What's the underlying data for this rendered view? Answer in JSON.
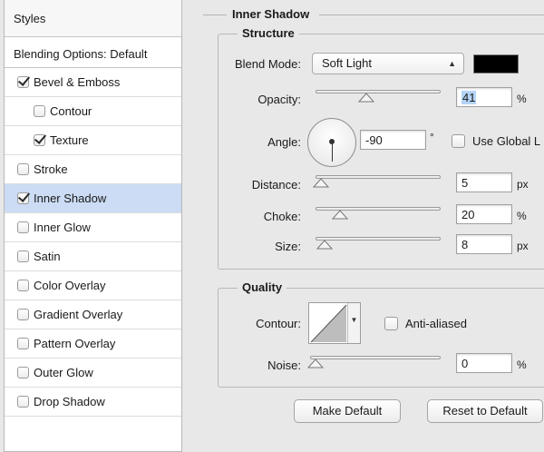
{
  "sidebar": {
    "header": "Styles",
    "blending_options": "Blending Options: Default",
    "items": [
      {
        "label": "Bevel & Emboss",
        "checked": true,
        "indent": false
      },
      {
        "label": "Contour",
        "checked": false,
        "indent": true
      },
      {
        "label": "Texture",
        "checked": true,
        "indent": true
      },
      {
        "label": "Stroke",
        "checked": false,
        "indent": false
      },
      {
        "label": "Inner Shadow",
        "checked": true,
        "indent": false,
        "selected": true
      },
      {
        "label": "Inner Glow",
        "checked": false,
        "indent": false
      },
      {
        "label": "Satin",
        "checked": false,
        "indent": false
      },
      {
        "label": "Color Overlay",
        "checked": false,
        "indent": false
      },
      {
        "label": "Gradient Overlay",
        "checked": false,
        "indent": false
      },
      {
        "label": "Pattern Overlay",
        "checked": false,
        "indent": false
      },
      {
        "label": "Outer Glow",
        "checked": false,
        "indent": false
      },
      {
        "label": "Drop Shadow",
        "checked": false,
        "indent": false
      }
    ]
  },
  "panel": {
    "title": "Inner Shadow",
    "structure": {
      "title": "Structure",
      "blend_mode_label": "Blend Mode:",
      "blend_mode_value": "Soft Light",
      "shadow_color": "#000000",
      "opacity_label": "Opacity:",
      "opacity_value": "41",
      "opacity_unit": "%",
      "angle_label": "Angle:",
      "angle_value": "-90",
      "angle_unit": "°",
      "global_light_label": "Use Global L",
      "global_light_checked": false,
      "distance_label": "Distance:",
      "distance_value": "5",
      "distance_unit": "px",
      "choke_label": "Choke:",
      "choke_value": "20",
      "choke_unit": "%",
      "size_label": "Size:",
      "size_value": "8",
      "size_unit": "px"
    },
    "quality": {
      "title": "Quality",
      "contour_label": "Contour:",
      "anti_aliased_label": "Anti-aliased",
      "anti_aliased_checked": false,
      "noise_label": "Noise:",
      "noise_value": "0",
      "noise_unit": "%"
    },
    "buttons": {
      "make_default": "Make Default",
      "reset_default": "Reset to Default"
    }
  }
}
